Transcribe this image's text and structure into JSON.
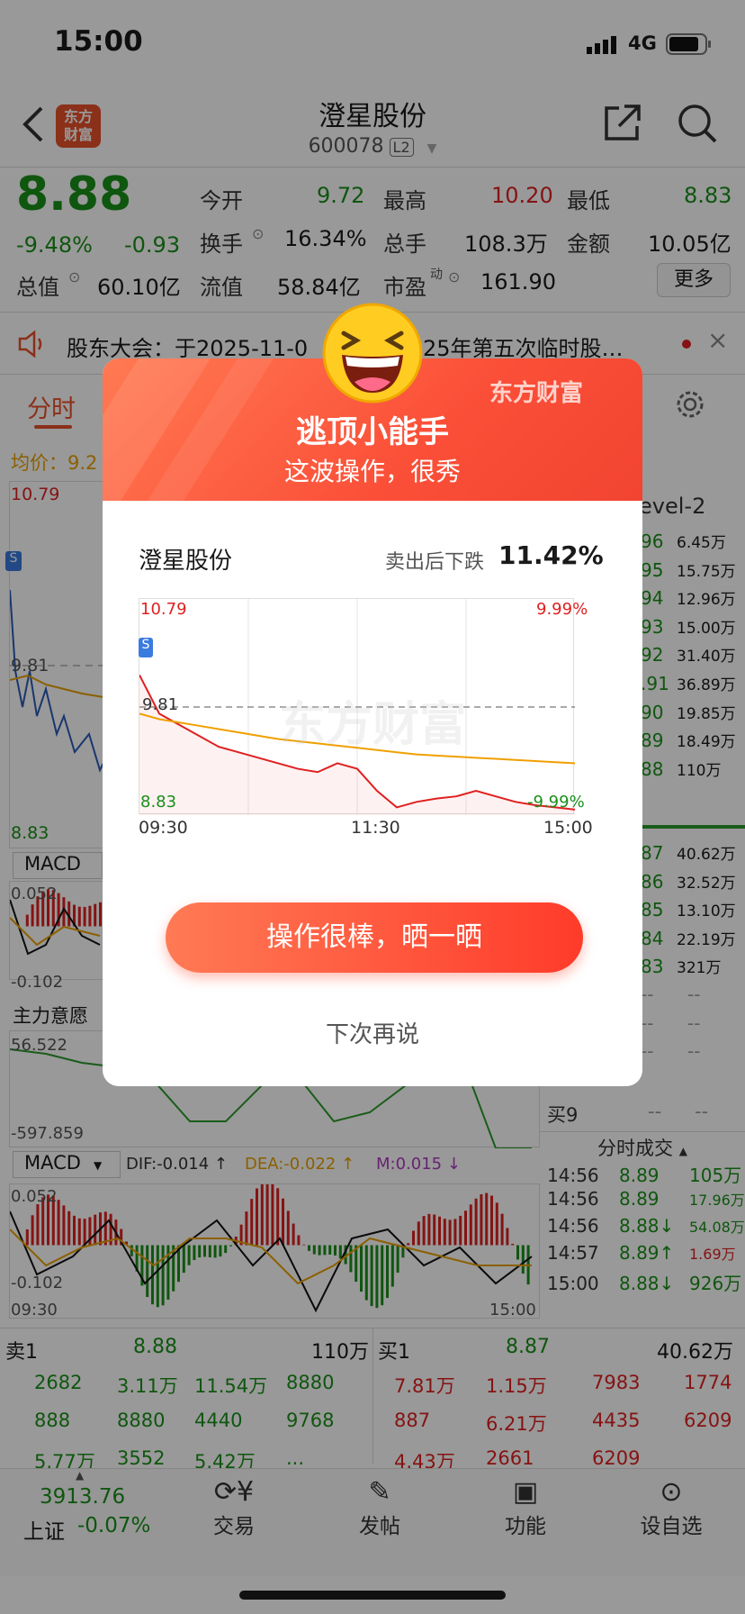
{
  "status": {
    "time": "15:00",
    "network": "4G"
  },
  "header": {
    "title": "澄星股份",
    "code": "600078",
    "l2": "L2",
    "logo_line1": "东方",
    "logo_line2": "财富"
  },
  "quote": {
    "price": "8.88",
    "change_pct": "-9.48%",
    "change": "-0.93",
    "open_label": "今开",
    "open": "9.72",
    "high_label": "最高",
    "high": "10.20",
    "low_label": "最低",
    "low": "8.83",
    "turnover_label": "换手",
    "turnover": "16.34%",
    "volume_label": "总手",
    "volume": "108.3万",
    "amount_label": "金额",
    "amount": "10.05亿",
    "mktcap_label": "总值",
    "mktcap": "60.10亿",
    "float_label": "流值",
    "float": "58.84亿",
    "pe_label": "市盈",
    "pe_sup": "动",
    "pe": "161.90",
    "more": "更多"
  },
  "notice": {
    "text": "股东大会：于2025-11-0",
    "text2": "25年第五次临时股…"
  },
  "tabs": {
    "fenshi": "分时",
    "avg_prefix": "均价：9.2"
  },
  "chart_labels": {
    "top": "10.79",
    "mid": "9.81",
    "bottom": "8.83",
    "macd": "MACD",
    "macd_top": "0.052",
    "macd_bottom": "-0.102",
    "zhuli": "主力意愿",
    "zhuli_top": "56.522",
    "zhuli_bottom": "-597.859",
    "macd2": "MACD",
    "dif": "DIF:-0.014 ↑",
    "dea": "DEA:-0.022 ↑",
    "m": "M:0.015 ↓",
    "t_start": "09:30",
    "t_end": "15:00",
    "level2": "evel-2"
  },
  "order_book": {
    "sell_prices": [
      "96",
      "95",
      "94",
      "93",
      "92",
      ".91",
      "90",
      "89",
      "88"
    ],
    "sell_vols": [
      "6.45万",
      "15.75万",
      "12.96万",
      "15.00万",
      "31.40万",
      "36.89万",
      "19.85万",
      "18.49万",
      "110万"
    ],
    "buy_prices": [
      "87",
      "86",
      "85",
      "84",
      "83"
    ],
    "buy_vols": [
      "40.62万",
      "32.52万",
      "13.10万",
      "22.19万",
      "321万"
    ],
    "buy9_label": "买9",
    "dash": "--"
  },
  "ticks": {
    "title": "分时成交",
    "rows": [
      {
        "t": "14:56",
        "p": "8.89",
        "v": "105万"
      },
      {
        "t": "14:56",
        "p": "8.89",
        "v": "17.96万"
      },
      {
        "t": "14:56",
        "p": "8.88↓",
        "v": "54.08万"
      },
      {
        "t": "14:57",
        "p": "8.89↑",
        "v": "1.69万"
      },
      {
        "t": "15:00",
        "p": "8.88↓",
        "v": "926万"
      }
    ]
  },
  "bottom_book": {
    "sell1_label": "卖1",
    "sell1_price": "8.88",
    "sell1_vol": "110万",
    "buy1_label": "买1",
    "buy1_price": "8.87",
    "buy1_vol": "40.62万",
    "left_rows": [
      [
        "2682",
        "3.11万",
        "11.54万",
        "8880"
      ],
      [
        "888",
        "8880",
        "4440",
        "9768"
      ],
      [
        "5.77万",
        "3552",
        "5.42万",
        "..."
      ]
    ],
    "right_rows": [
      [
        "7.81万",
        "1.15万",
        "7983",
        "1774"
      ],
      [
        "887",
        "6.21万",
        "4435",
        "6209"
      ],
      [
        "4.43万",
        "2661",
        "6209",
        ""
      ]
    ]
  },
  "bottom_nav": {
    "index_value": "3913.76",
    "index_name": "上证",
    "index_change": "-0.07%",
    "trade": "交易",
    "post": "发帖",
    "func": "功能",
    "watch": "设自选"
  },
  "modal": {
    "title": "逃顶小能手",
    "subtitle": "这波操作，很秀",
    "brand": "东方财富",
    "stock": "澄星股份",
    "drop_label": "卖出后下跌",
    "drop_value": "11.42%",
    "top_price": "10.79",
    "top_pct": "9.99%",
    "mid_price": "9.81",
    "bottom_price": "8.83",
    "bottom_pct": "-9.99%",
    "t_start": "09:30",
    "t_mid": "11:30",
    "t_end": "15:00",
    "watermark": "东方财富",
    "sell_marker": "S",
    "share_button": "操作很棒，晒一晒",
    "later": "下次再说"
  },
  "chart_data": {
    "type": "line",
    "title": "",
    "x": [
      "09:30",
      "11:30",
      "15:00"
    ],
    "ylim": [
      8.83,
      10.79
    ],
    "series": [
      {
        "values": [
          10.1,
          9.75,
          9.65,
          9.55,
          9.45,
          9.4,
          9.35,
          9.3,
          9.25,
          9.22,
          9.3,
          9.25,
          9.05,
          8.9,
          8.95,
          8.98,
          9.0,
          9.05,
          9.0,
          8.95,
          8.92,
          8.9,
          8.88
        ]
      },
      {
        "values": [
          9.75,
          9.7,
          9.67,
          9.64,
          9.61,
          9.58,
          9.55,
          9.52,
          9.5,
          9.48,
          9.46,
          9.44,
          9.42,
          9.4,
          9.38,
          9.37,
          9.36,
          9.35,
          9.34,
          9.33,
          9.32,
          9.31,
          9.3
        ]
      }
    ]
  }
}
